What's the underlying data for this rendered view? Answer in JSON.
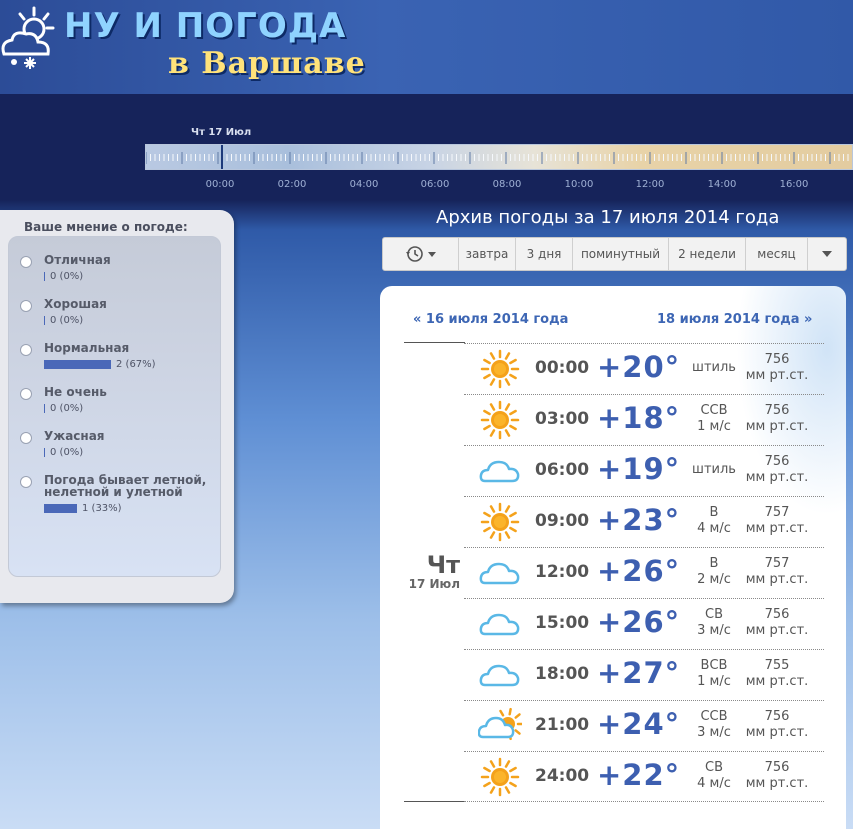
{
  "header": {
    "logo_line1": "НУ И ПОГОДА",
    "logo_line2": "в Варшаве"
  },
  "timeline": {
    "current_date": "Чт 17 Июл",
    "labels": [
      "00:00",
      "02:00",
      "04:00",
      "06:00",
      "08:00",
      "10:00",
      "12:00",
      "14:00",
      "16:00"
    ]
  },
  "poll": {
    "title": "Ваше мнение о погоде:",
    "options": [
      {
        "label": "Отличная",
        "count": "0 (0%)",
        "percent": 0
      },
      {
        "label": "Хорошая",
        "count": "0 (0%)",
        "percent": 0
      },
      {
        "label": "Нормальная",
        "count": "2 (67%)",
        "percent": 67
      },
      {
        "label": "Не очень",
        "count": "0 (0%)",
        "percent": 0
      },
      {
        "label": "Ужасная",
        "count": "0 (0%)",
        "percent": 0
      },
      {
        "label": "Погода бывает летной, нелетной и улетной",
        "count": "1 (33%)",
        "percent": 33
      }
    ]
  },
  "archive": {
    "title": "Архив погоды за 17 июля 2014 года",
    "toolbar": [
      "завтра",
      "3 дня",
      "поминутный",
      "2 недели",
      "месяц"
    ],
    "prev_link": "« 16 июля 2014 года",
    "next_link": "18 июля 2014 года »",
    "day_name": "Чт",
    "day_date": "17 Июл",
    "rows": [
      {
        "time": "00:00",
        "temp": "+20°",
        "wind_dir": "штиль",
        "wind_speed": "",
        "pressure": "756",
        "unit": "мм рт.ст.",
        "icon": "sun-icon"
      },
      {
        "time": "03:00",
        "temp": "+18°",
        "wind_dir": "ССВ",
        "wind_speed": "1 м/с",
        "pressure": "756",
        "unit": "мм рт.ст.",
        "icon": "sun-icon"
      },
      {
        "time": "06:00",
        "temp": "+19°",
        "wind_dir": "штиль",
        "wind_speed": "",
        "pressure": "756",
        "unit": "мм рт.ст.",
        "icon": "cloud-icon"
      },
      {
        "time": "09:00",
        "temp": "+23°",
        "wind_dir": "В",
        "wind_speed": "4 м/с",
        "pressure": "757",
        "unit": "мм рт.ст.",
        "icon": "sun-icon"
      },
      {
        "time": "12:00",
        "temp": "+26°",
        "wind_dir": "В",
        "wind_speed": "2 м/с",
        "pressure": "757",
        "unit": "мм рт.ст.",
        "icon": "cloud-icon"
      },
      {
        "time": "15:00",
        "temp": "+26°",
        "wind_dir": "СВ",
        "wind_speed": "3 м/с",
        "pressure": "756",
        "unit": "мм рт.ст.",
        "icon": "cloud-icon"
      },
      {
        "time": "18:00",
        "temp": "+27°",
        "wind_dir": "ВСВ",
        "wind_speed": "1 м/с",
        "pressure": "755",
        "unit": "мм рт.ст.",
        "icon": "cloud-icon"
      },
      {
        "time": "21:00",
        "temp": "+24°",
        "wind_dir": "ССВ",
        "wind_speed": "3 м/с",
        "pressure": "756",
        "unit": "мм рт.ст.",
        "icon": "sun-cloud-icon"
      },
      {
        "time": "24:00",
        "temp": "+22°",
        "wind_dir": "СВ",
        "wind_speed": "4 м/с",
        "pressure": "756",
        "unit": "мм рт.ст.",
        "icon": "sun-icon"
      }
    ]
  },
  "colors": {
    "header_bg": "#3159a8",
    "temp_text": "#3d5fb0",
    "link": "#3d66b4",
    "poll_bar": "#4a68b8",
    "sun": "#f4a21b",
    "cloud": "#5ab8e6"
  }
}
